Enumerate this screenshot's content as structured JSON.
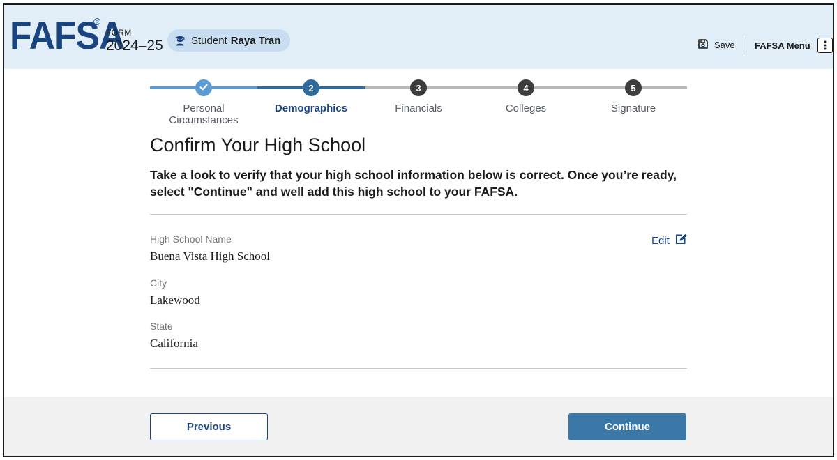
{
  "header": {
    "logo": "FAFSA",
    "logo_mark": "®",
    "form_label": "FORM",
    "form_year": "2024–25",
    "student_label": "Student",
    "student_name": "Raya Tran",
    "save_label": "Save",
    "menu_label": "FAFSA Menu"
  },
  "stepper": {
    "steps": [
      {
        "number": "1",
        "label": "Personal Circumstances",
        "status": "complete"
      },
      {
        "number": "2",
        "label": "Demographics",
        "status": "current"
      },
      {
        "number": "3",
        "label": "Financials",
        "status": "upcoming"
      },
      {
        "number": "4",
        "label": "Colleges",
        "status": "upcoming"
      },
      {
        "number": "5",
        "label": "Signature",
        "status": "upcoming"
      }
    ],
    "colors": {
      "complete": "#5b9bd1",
      "current": "#2e6a9b",
      "upcoming_line": "#b7b7b7",
      "upcoming_dot": "#3d3d3d"
    }
  },
  "main": {
    "title": "Confirm Your High School",
    "intro": "Take a look to verify that your high school information below is correct. Once you’re ready, select \"Continue\" and well add this high school to your FAFSA.",
    "edit_label": "Edit",
    "fields": [
      {
        "label": "High School Name",
        "value": "Buena Vista High School"
      },
      {
        "label": "City",
        "value": "Lakewood"
      },
      {
        "label": "State",
        "value": "California"
      }
    ]
  },
  "footer": {
    "previous_label": "Previous",
    "continue_label": "Continue"
  },
  "icons": {
    "student": "student-icon",
    "save": "floppy-disk-icon",
    "menu": "kebab-menu-icon",
    "edit": "edit-pencil-icon",
    "check": "checkmark-icon"
  },
  "colors": {
    "brand": "#1a4480",
    "header_bg": "#e1eef8",
    "primary_button": "#3b78a8",
    "footer_bg": "#f0f0f0"
  }
}
